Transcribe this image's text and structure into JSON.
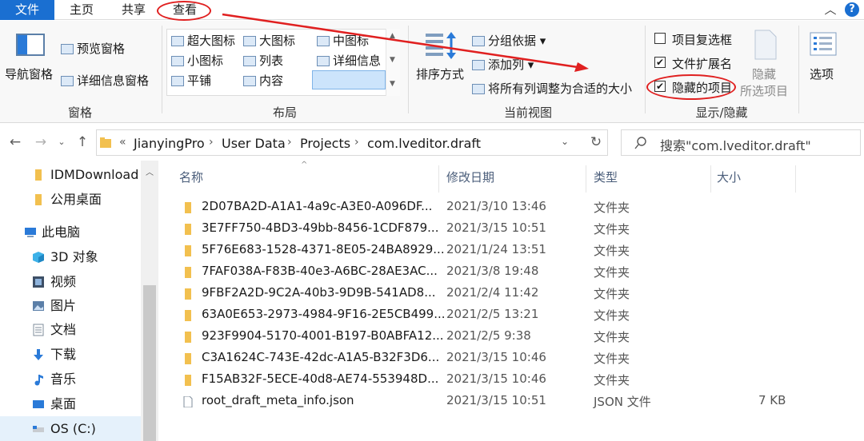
{
  "tabs": {
    "file": "文件",
    "home": "主页",
    "share": "共享",
    "view": "查看"
  },
  "ribbon": {
    "pane": {
      "nav_pane": "导航窗格",
      "preview_pane": "预览窗格",
      "details_pane": "详细信息窗格",
      "group_label": "窗格"
    },
    "layout": {
      "options": [
        "超大图标",
        "大图标",
        "中图标",
        "小图标",
        "列表",
        "详细信息",
        "平铺",
        "内容"
      ],
      "selected": "详细信息",
      "group_label": "布局"
    },
    "current_view": {
      "sort_by": "排序方式",
      "group_by": "分组依据",
      "add_columns": "添加列",
      "size_all_columns": "将所有列调整为合适的大小",
      "group_label": "当前视图"
    },
    "show_hide": {
      "item_check_boxes": "项目复选框",
      "item_check_boxes_checked": false,
      "file_name_extensions": "文件扩展名",
      "file_name_extensions_checked": true,
      "hidden_items": "隐藏的项目",
      "hidden_items_checked": true,
      "hide_selected_line1": "隐藏",
      "hide_selected_line2": "所选项目",
      "group_label": "显示/隐藏"
    },
    "options": "选项"
  },
  "address": {
    "overflow": "«",
    "crumbs": [
      "JianyingPro",
      "User Data",
      "Projects",
      "com.lveditor.draft"
    ]
  },
  "search": {
    "placeholder": "搜索\"com.lveditor.draft\""
  },
  "nav": {
    "items": [
      {
        "label": "IDMDownload",
        "icon": "folder-icon"
      },
      {
        "label": "公用桌面",
        "icon": "folder-icon"
      },
      {
        "label": "此电脑",
        "icon": "pc-icon"
      },
      {
        "label": "3D 对象",
        "icon": "cube-icon"
      },
      {
        "label": "视频",
        "icon": "video-icon"
      },
      {
        "label": "图片",
        "icon": "picture-icon"
      },
      {
        "label": "文档",
        "icon": "document-icon"
      },
      {
        "label": "下载",
        "icon": "download-icon"
      },
      {
        "label": "音乐",
        "icon": "music-icon"
      },
      {
        "label": "桌面",
        "icon": "desktop-icon"
      },
      {
        "label": "OS (C:)",
        "icon": "drive-icon"
      }
    ]
  },
  "columns": {
    "name": "名称",
    "date": "修改日期",
    "type": "类型",
    "size": "大小"
  },
  "files": [
    {
      "name": "2D07BA2D-A1A1-4a9c-A3E0-A096DF...",
      "date": "2021/3/10 13:46",
      "type": "文件夹",
      "size": "",
      "kind": "folder"
    },
    {
      "name": "3E7FF750-4BD3-49bb-8456-1CDF879...",
      "date": "2021/3/15 10:51",
      "type": "文件夹",
      "size": "",
      "kind": "folder"
    },
    {
      "name": "5F76E683-1528-4371-8E05-24BA8929...",
      "date": "2021/1/24 13:51",
      "type": "文件夹",
      "size": "",
      "kind": "folder"
    },
    {
      "name": "7FAF038A-F83B-40e3-A6BC-28AE3AC...",
      "date": "2021/3/8 19:48",
      "type": "文件夹",
      "size": "",
      "kind": "folder"
    },
    {
      "name": "9FBF2A2D-9C2A-40b3-9D9B-541AD8...",
      "date": "2021/2/4 11:42",
      "type": "文件夹",
      "size": "",
      "kind": "folder"
    },
    {
      "name": "63A0E653-2973-4984-9F16-2E5CB499...",
      "date": "2021/2/5 13:21",
      "type": "文件夹",
      "size": "",
      "kind": "folder"
    },
    {
      "name": "923F9904-5170-4001-B197-B0ABFA12...",
      "date": "2021/2/5 9:38",
      "type": "文件夹",
      "size": "",
      "kind": "folder"
    },
    {
      "name": "C3A1624C-743E-42dc-A1A5-B32F3D6...",
      "date": "2021/3/15 10:46",
      "type": "文件夹",
      "size": "",
      "kind": "folder"
    },
    {
      "name": "F15AB32F-5ECE-40d8-AE74-553948D...",
      "date": "2021/3/15 10:46",
      "type": "文件夹",
      "size": "",
      "kind": "folder"
    },
    {
      "name": "root_draft_meta_info.json",
      "date": "2021/3/15 10:51",
      "type": "JSON 文件",
      "size": "7 KB",
      "kind": "file"
    }
  ],
  "colors": {
    "accent": "#1a6fd1",
    "annotation_red": "#e02020",
    "folder": "#f2c04f"
  }
}
